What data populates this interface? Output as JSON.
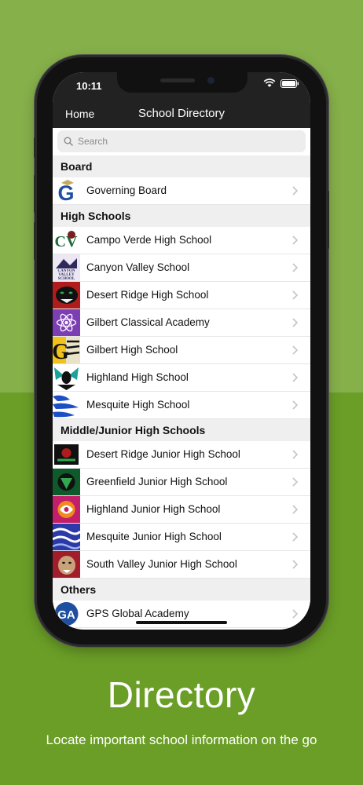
{
  "status_bar": {
    "time": "10:11"
  },
  "nav": {
    "back_label": "Home",
    "title": "School Directory"
  },
  "search": {
    "placeholder": "Search"
  },
  "sections": [
    {
      "title": "Board",
      "items": [
        {
          "name": "Governing Board"
        }
      ]
    },
    {
      "title": "High Schools",
      "items": [
        {
          "name": "Campo Verde High School"
        },
        {
          "name": "Canyon Valley School"
        },
        {
          "name": "Desert Ridge High School"
        },
        {
          "name": "Gilbert Classical Academy"
        },
        {
          "name": "Gilbert High School"
        },
        {
          "name": "Highland High School"
        },
        {
          "name": "Mesquite High School"
        }
      ]
    },
    {
      "title": "Middle/Junior High Schools",
      "items": [
        {
          "name": "Desert Ridge Junior High School"
        },
        {
          "name": "Greenfield Junior High School"
        },
        {
          "name": "Highland Junior High School"
        },
        {
          "name": "Mesquite Junior High School"
        },
        {
          "name": "South Valley Junior High School"
        }
      ]
    },
    {
      "title": "Others",
      "items": [
        {
          "name": "GPS Global Academy"
        }
      ]
    }
  ],
  "logo_text": {
    "governing": "G",
    "campo": "CV",
    "canyon": "CANYON VALLEY SCHOOL",
    "gilbert": "G",
    "global": "GA"
  },
  "promo": {
    "headline": "Directory",
    "tagline": "Locate important school information on the go"
  },
  "colors": {
    "background_top": "#86b04a",
    "background_bottom": "#6a9e27",
    "nav_bar": "#222222",
    "section_header": "#efefef"
  }
}
